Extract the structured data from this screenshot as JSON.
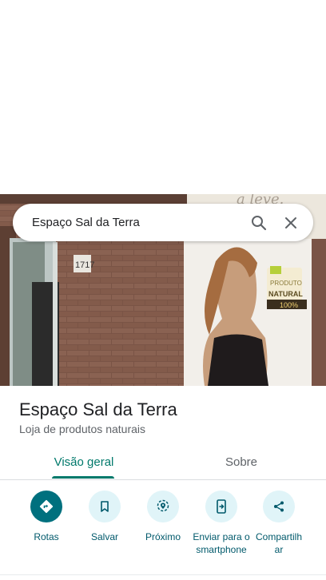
{
  "search": {
    "query": "Espaço Sal da Terra"
  },
  "place": {
    "name": "Espaço Sal da Terra",
    "category": "Loja de produtos naturais",
    "photo": {
      "badge_line1": "PRODUTO",
      "badge_line2": "NATURAL",
      "badge_line3": "100%",
      "door_number": "1717",
      "wall_text": "a leve."
    }
  },
  "tabs": [
    {
      "label": "Visão geral",
      "active": true
    },
    {
      "label": "Sobre",
      "active": false
    }
  ],
  "actions": [
    {
      "label": "Rotas",
      "icon": "directions-icon"
    },
    {
      "label": "Salvar",
      "icon": "bookmark-icon"
    },
    {
      "label": "Próximo",
      "icon": "nearby-icon"
    },
    {
      "label": "Enviar para o smartphone",
      "icon": "send-to-phone-icon"
    },
    {
      "label": "Compartilhar",
      "icon": "share-icon"
    }
  ],
  "colors": {
    "accent": "#00796b",
    "action_bg": "#e0f4f8",
    "primary_action": "#00707e"
  }
}
